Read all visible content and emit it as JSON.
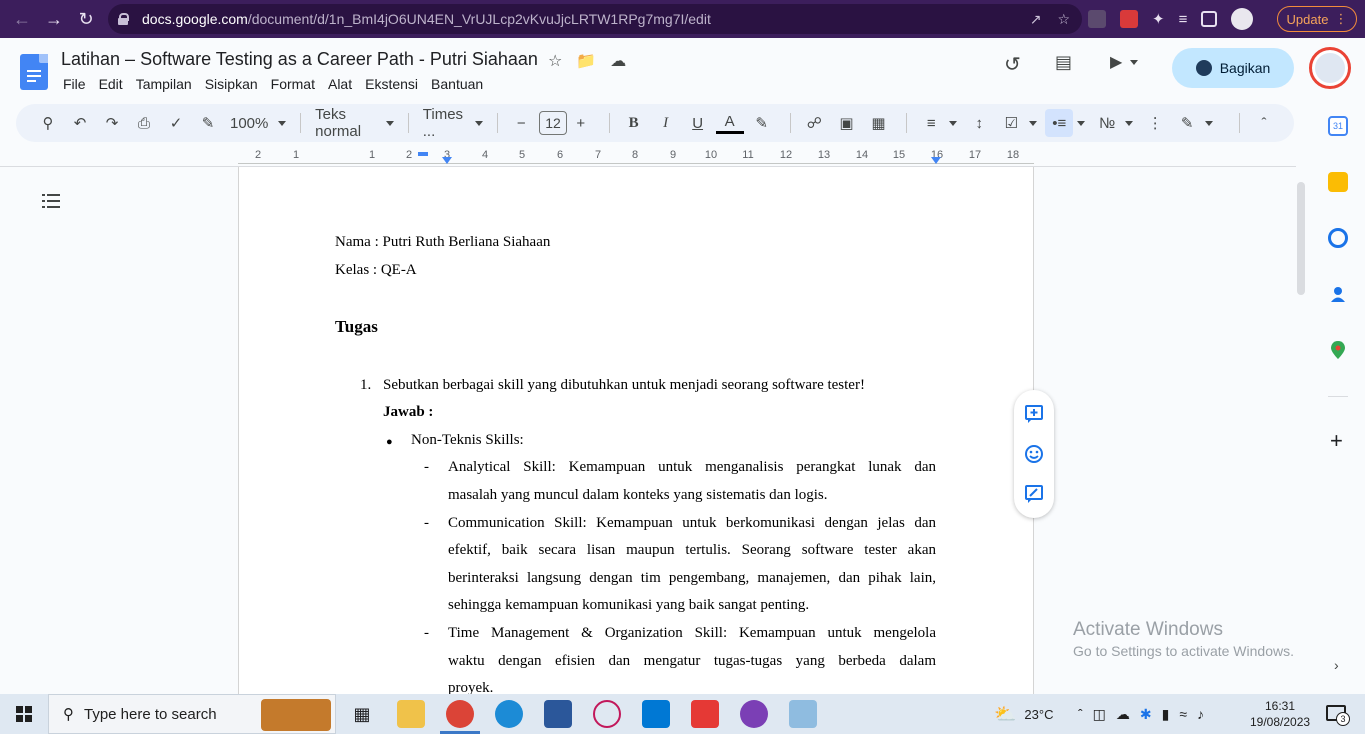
{
  "browser": {
    "url_domain": "docs.google.com",
    "url_path": "/document/d/1n_BmI4jO6UN4EN_VrUJLcp2vKvuJjcLRTW1RPg7mg7I/edit",
    "update_label": "Update"
  },
  "header": {
    "title": "Latihan – Software Testing as a Career Path - Putri Siahaan",
    "menu": [
      "File",
      "Edit",
      "Tampilan",
      "Sisipkan",
      "Format",
      "Alat",
      "Ekstensi",
      "Bantuan"
    ],
    "share_label": "Bagikan"
  },
  "toolbar": {
    "zoom": "100%",
    "style": "Teks normal",
    "font": "Times ...",
    "font_size": "12"
  },
  "ruler": {
    "labels": [
      "2",
      "1",
      "1",
      "2",
      "3",
      "4",
      "5",
      "6",
      "7",
      "8",
      "9",
      "10",
      "11",
      "12",
      "13",
      "14",
      "15",
      "16",
      "17",
      "18"
    ]
  },
  "document": {
    "nama": "Nama : Putri Ruth Berliana Siahaan",
    "kelas": "Kelas : QE-A",
    "heading": "Tugas",
    "q1_number": "1.",
    "q1_text": "Sebutkan berbagai skill yang dibutuhkan untuk menjadi seorang software tester!",
    "jawab": "Jawab :",
    "bullet_marker": "●",
    "bullet_text": "Non-Teknis Skills:",
    "dash": "-",
    "items": [
      {
        "lines": [
          "Analytical Skill: Kemampuan untuk menganalisis perangkat lunak dan",
          "masalah yang muncul dalam konteks yang sistematis dan logis."
        ]
      },
      {
        "lines": [
          "Communication Skill: Kemampuan untuk berkomunikasi dengan jelas dan",
          "efektif, baik secara lisan maupun tertulis. Seorang software tester akan",
          "berinteraksi langsung dengan tim pengembang, manajemen, dan pihak lain,",
          "sehingga kemampuan komunikasi yang baik sangat penting."
        ]
      },
      {
        "lines": [
          "Time Management & Organization Skill: Kemampuan untuk mengelola",
          "waktu dengan efisien dan mengatur tugas-tugas yang berbeda dalam",
          "proyek."
        ]
      }
    ]
  },
  "watermark": {
    "title": "Activate Windows",
    "subtitle": "Go to Settings to activate Windows."
  },
  "taskbar": {
    "search_placeholder": "Type here to search",
    "weather": "23°C",
    "time": "16:31",
    "date": "19/08/2023",
    "notification_count": "3"
  },
  "colors": {
    "browser_chrome": "#3c1e5c",
    "accent_blue": "#1a73e8",
    "share_button": "#c2e7ff",
    "toolbar_bg": "#edf2fa"
  }
}
